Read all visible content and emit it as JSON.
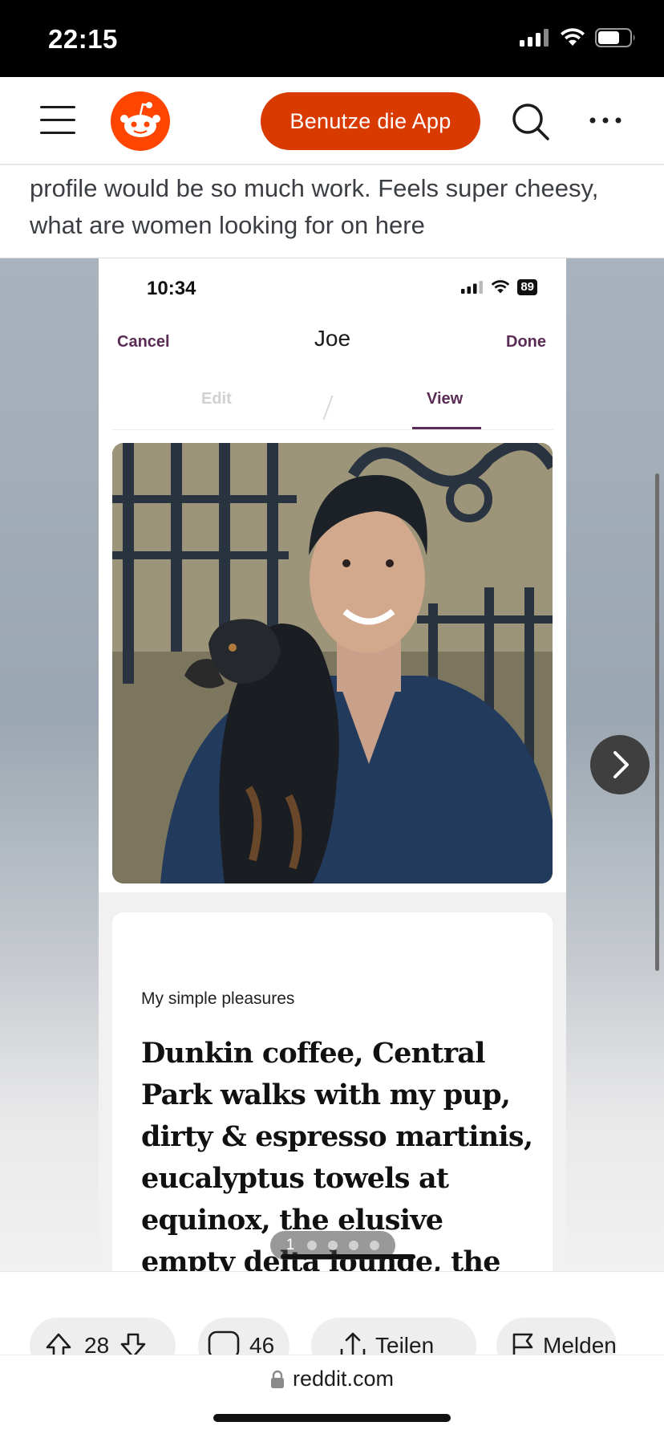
{
  "status_bar": {
    "time": "22:15"
  },
  "header": {
    "app_button_label": "Benutze die App"
  },
  "post": {
    "text": "profile would be so much work. Feels super cheesy, what are women looking for on here"
  },
  "embedded_screenshot": {
    "status_time": "10:34",
    "battery": "89",
    "cancel_label": "Cancel",
    "profile_name": "Joe",
    "done_label": "Done",
    "tabs": [
      {
        "label": "Edit",
        "active": false
      },
      {
        "label": "View",
        "active": true
      }
    ],
    "accent_color": "#5b2c55",
    "prompt_title": "My simple pleasures",
    "prompt_answer": "Dunkin coffee, Central Park walks with my pup, dirty & espresso martinis, eucalyptus towels at equinox, the elusive empty delta lounge, the campiest"
  },
  "gallery": {
    "current_index": "1",
    "total_dots": 5
  },
  "actions": {
    "upvote_count": "28",
    "comment_count": "46",
    "share_label": "Teilen",
    "report_label": "Melden"
  },
  "url_bar": {
    "domain": "reddit.com"
  },
  "colors": {
    "reddit_orange": "#ff4500",
    "app_button": "#d93a00"
  }
}
